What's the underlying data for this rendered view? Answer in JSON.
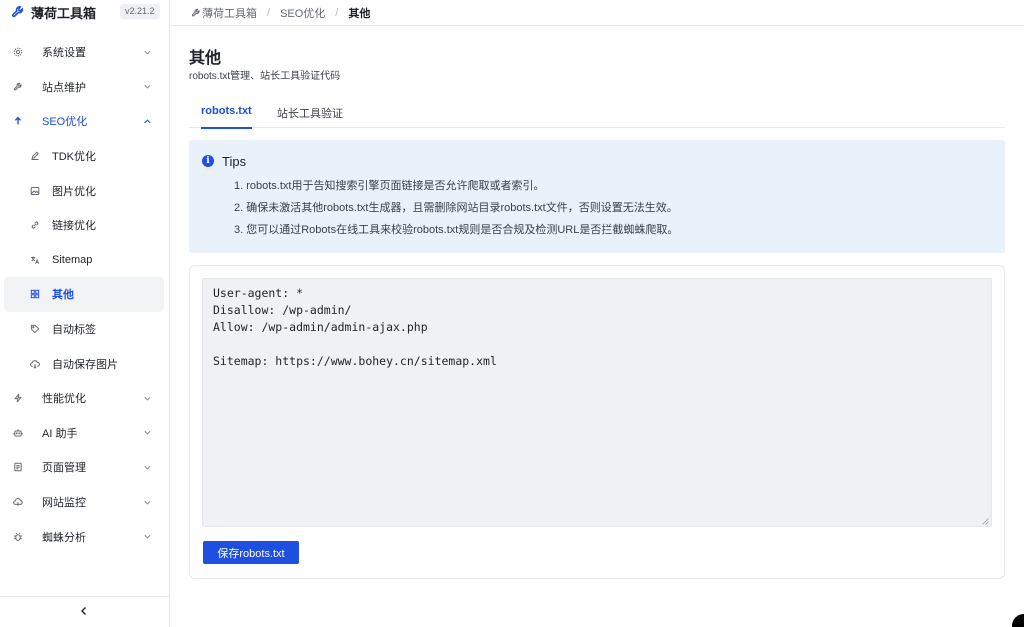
{
  "app": {
    "title": "薄荷工具箱",
    "version": "v2.21.2"
  },
  "sidebar": {
    "items": [
      {
        "key": "system-settings",
        "label": "系统设置",
        "icon": "gear-icon",
        "expandable": true
      },
      {
        "key": "site-maintenance",
        "label": "站点维护",
        "icon": "wrench-icon",
        "expandable": true
      },
      {
        "key": "seo",
        "label": "SEO优化",
        "icon": "arrow-up-icon",
        "expandable": true,
        "expanded": true,
        "children": [
          {
            "key": "tdk",
            "label": "TDK优化",
            "icon": "pencil-icon"
          },
          {
            "key": "image-opt",
            "label": "图片优化",
            "icon": "image-icon"
          },
          {
            "key": "link-opt",
            "label": "链接优化",
            "icon": "link-icon"
          },
          {
            "key": "sitemap",
            "label": "Sitemap",
            "icon": "translate-icon"
          },
          {
            "key": "other",
            "label": "其他",
            "icon": "grid-icon",
            "active": true
          },
          {
            "key": "auto-tag",
            "label": "自动标签",
            "icon": "tag-icon"
          },
          {
            "key": "auto-save-img",
            "label": "自动保存图片",
            "icon": "cloud-download-icon"
          }
        ]
      },
      {
        "key": "performance",
        "label": "性能优化",
        "icon": "bolt-icon",
        "expandable": true
      },
      {
        "key": "ai",
        "label": "AI 助手",
        "icon": "robot-icon",
        "expandable": true
      },
      {
        "key": "pages",
        "label": "页面管理",
        "icon": "document-icon",
        "expandable": true
      },
      {
        "key": "monitor",
        "label": "网站监控",
        "icon": "cloud-icon",
        "expandable": true
      },
      {
        "key": "spider",
        "label": "蜘蛛分析",
        "icon": "bug-icon",
        "expandable": true
      }
    ]
  },
  "breadcrumb": {
    "items": [
      "薄荷工具箱",
      "SEO优化"
    ],
    "current": "其他"
  },
  "page": {
    "title": "其他",
    "subtitle": "robots.txt管理、站长工具验证代码"
  },
  "tabs": [
    {
      "label": "robots.txt",
      "active": true
    },
    {
      "label": "站长工具验证",
      "active": false
    }
  ],
  "tips": {
    "title": "Tips",
    "lines": [
      "1. robots.txt用于告知搜索引擎页面链接是否允许爬取或者索引。",
      "2. 确保未激活其他robots.txt生成器，且需删除网站目录robots.txt文件，否则设置无法生效。",
      "3. 您可以通过Robots在线工具来校验robots.txt规则是否合规及检测URL是否拦截蜘蛛爬取。"
    ]
  },
  "editor": {
    "value": "User-agent: *\nDisallow: /wp-admin/\nAllow: /wp-admin/admin-ajax.php\n\nSitemap: https://www.bohey.cn/sitemap.xml"
  },
  "actions": {
    "save_label": "保存robots.txt"
  },
  "colors": {
    "accent": "#1e4fe0",
    "tips_bg": "#e9f1fb",
    "editor_bg": "#f0f1f2"
  }
}
